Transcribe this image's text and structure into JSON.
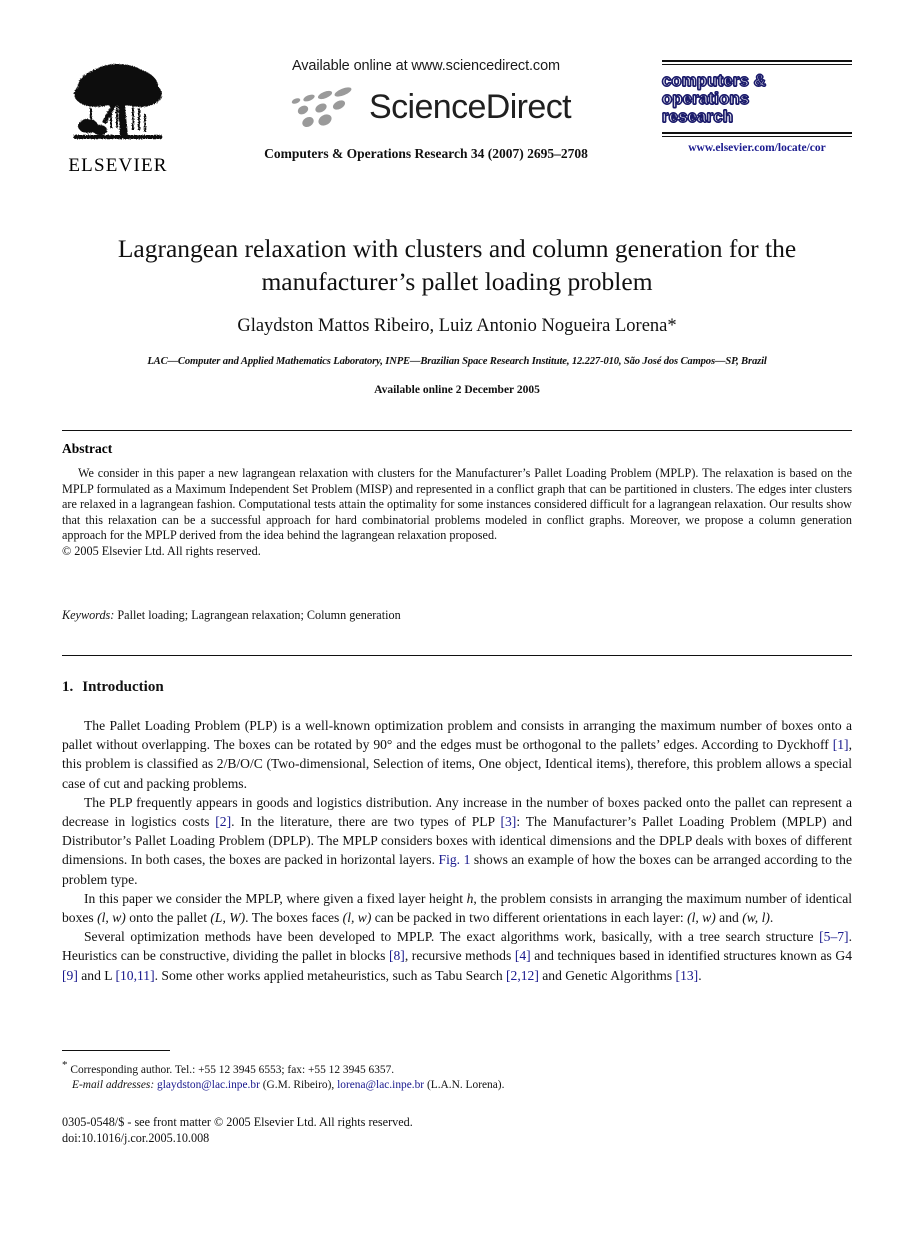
{
  "header": {
    "publisher_name": "ELSEVIER",
    "publisher_logo_icon": "elsevier-tree-logo",
    "available_online_at": "Available online at www.sciencedirect.com",
    "sciencedirect_wordmark": "ScienceDirect",
    "sciencedirect_swoosh_icon": "sciencedirect-swoosh-icon",
    "journal_citation": "Computers & Operations Research 34 (2007) 2695–2708",
    "journal_logo": {
      "line1": "computers &",
      "line2": "operations",
      "line3": "research",
      "url": "www.elsevier.com/locate/cor"
    }
  },
  "article": {
    "title": "Lagrangean relaxation with clusters and column generation for the manufacturer’s pallet loading problem",
    "authors": "Glaydston Mattos Ribeiro, Luiz Antonio Nogueira Lorena*",
    "affiliation": "LAC—Computer and Applied Mathematics Laboratory, INPE—Brazilian Space Research Institute, 12.227-010, São José dos Campos—SP, Brazil",
    "available_online": "Available online 2 December 2005"
  },
  "abstract": {
    "heading": "Abstract",
    "body": "We consider in this paper a new lagrangean relaxation with clusters for the Manufacturer’s Pallet Loading Problem (MPLP). The relaxation is based on the MPLP formulated as a Maximum Independent Set Problem (MISP) and represented in a conflict graph that can be partitioned in clusters. The edges inter clusters are relaxed in a lagrangean fashion. Computational tests attain the optimality for some instances considered difficult for a lagrangean relaxation. Our results show that this relaxation can be a successful approach for hard combinatorial problems modeled in conflict graphs. Moreover, we propose a column generation approach for the MPLP derived from the idea behind the lagrangean relaxation proposed.",
    "copyright": "© 2005 Elsevier Ltd. All rights reserved."
  },
  "keywords": {
    "label": "Keywords:",
    "value": " Pallet loading; Lagrangean relaxation; Column generation"
  },
  "section": {
    "number": "1.",
    "title": "Introduction"
  },
  "paragraphs": {
    "p1_a": "The Pallet Loading Problem (PLP) is a well-known optimization problem and consists in arranging the maximum number of boxes onto a pallet without overlapping. The boxes can be rotated by 90° and the edges must be orthogonal to the pallets’ edges. According to Dyckhoff ",
    "p1_cite1": "[1]",
    "p1_b": ", this problem is classified as 2/B/O/C (Two-dimensional, Selection of items, One object, Identical items), therefore, this problem allows a special case of cut and packing problems.",
    "p2_a": "The PLP frequently appears in goods and logistics distribution. Any increase in the number of boxes packed onto the pallet can represent a decrease in logistics costs ",
    "p2_cite2": "[2]",
    "p2_b": ". In the literature, there are two types of PLP ",
    "p2_cite3": "[3]",
    "p2_c": ": The Manufacturer’s Pallet Loading Problem (MPLP) and Distributor’s Pallet Loading Problem (DPLP). The MPLP considers boxes with identical dimensions and the DPLP deals with boxes of different dimensions. In both cases, the boxes are packed in horizontal layers. ",
    "p2_figref": "Fig. 1",
    "p2_d": " shows an example of how the boxes can be arranged according to the problem type.",
    "p3_a": "In this paper we consider the MPLP, where given a fixed layer height ",
    "p3_h": "h",
    "p3_b": ", the problem consists in arranging the maximum number of identical boxes ",
    "p3_lw1": "(l, w)",
    "p3_c": " onto the pallet ",
    "p3_LW": "(L, W)",
    "p3_d": ". The boxes faces ",
    "p3_lw2": "(l, w)",
    "p3_e": " can be packed in two different orientations in each layer: ",
    "p3_lw3": "(l, w)",
    "p3_f": " and ",
    "p3_wl": "(w, l)",
    "p3_g": ".",
    "p4_a": "Several optimization methods have been developed to MPLP. The exact algorithms work, basically, with a tree search structure ",
    "p4_cite57": "[5–7]",
    "p4_b": ". Heuristics can be constructive, dividing the pallet in blocks ",
    "p4_cite8": "[8]",
    "p4_c": ", recursive methods ",
    "p4_cite4": "[4]",
    "p4_d": " and techniques based in identified structures known as G4 ",
    "p4_cite9": "[9]",
    "p4_e": " and L ",
    "p4_cite1011": "[10,11]",
    "p4_f": ". Some other works applied metaheuristics, such as Tabu Search ",
    "p4_cite212": "[2,12]",
    "p4_g": " and Genetic Algorithms ",
    "p4_cite13": "[13]",
    "p4_h": "."
  },
  "footnote": {
    "star": "*",
    "corresponding": " Corresponding author. Tel.: +55 12 3945 6553; fax: +55 12 3945 6357.",
    "email_label": "E-mail addresses:",
    "email1": "glaydston@lac.inpe.br",
    "email1_owner": " (G.M. Ribeiro), ",
    "email2": "lorena@lac.inpe.br",
    "email2_owner": " (L.A.N. Lorena)."
  },
  "footer": {
    "front_matter": "0305-0548/$ - see front matter © 2005 Elsevier Ltd. All rights reserved.",
    "doi": "doi:10.1016/j.cor.2005.10.008"
  },
  "colors": {
    "link": "#17178c",
    "journal_outline": "#1b1b6b",
    "text": "#111111"
  }
}
